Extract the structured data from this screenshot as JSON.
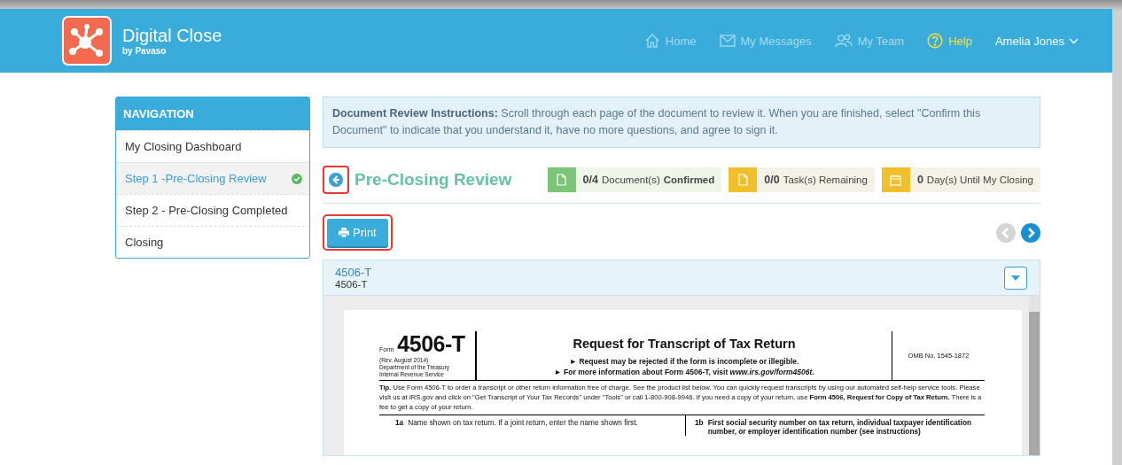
{
  "app": {
    "title": "Digital Close",
    "subtitle": "by Pavaso"
  },
  "top_nav": [
    {
      "label": "Home",
      "kind": "home"
    },
    {
      "label": "My Messages",
      "kind": "messages"
    },
    {
      "label": "My Team",
      "kind": "team"
    },
    {
      "label": "Help",
      "kind": "help"
    }
  ],
  "user": {
    "name": "Amelia Jones"
  },
  "sidebar": {
    "title": "NAVIGATION",
    "items": [
      {
        "label": "My Closing Dashboard",
        "selected": false,
        "completed": false
      },
      {
        "label": "Step 1 -Pre-Closing Review",
        "selected": true,
        "completed": true
      },
      {
        "label": "Step 2 - Pre-Closing Completed",
        "selected": false,
        "completed": false
      },
      {
        "label": "Closing",
        "selected": false,
        "completed": false
      }
    ]
  },
  "instructions": {
    "text": "**Document Review Instructions:** Scroll through each page of the document to review it. When you are finished, select \"Confirm this Document\" to indicate that you understand it, have no more questions, and agree to sign it."
  },
  "page_title": "Pre-Closing Review",
  "back_button": {
    "highlighted": true
  },
  "stats": [
    {
      "count": "0/4",
      "label": "Document(s) **Confirmed**",
      "color": "#7cc576",
      "kind": "document"
    },
    {
      "count": "0/0",
      "label": "Task(s) Remaining",
      "color": "#f0c02c",
      "kind": "document"
    },
    {
      "count": "0",
      "label": "Day(s) Until My Closing",
      "color": "#f0c02c",
      "kind": "calendar"
    }
  ],
  "print_button": {
    "label": "Print",
    "highlighted": true
  },
  "pager": {
    "previous_disabled": true,
    "next_disabled": false
  },
  "document": {
    "title": "4506-T",
    "subtitle": "4506-T",
    "form_word": "Form",
    "form_number": "4506-T",
    "revision": "(Rev. August 2014)",
    "department": "Department of the Treasury",
    "service": "Internal Revenue Service",
    "heading": "Request for Transcript of Tax Return",
    "notes": [
      "► Request may be rejected if the form is incomplete or illegible.",
      "► For more information about Form 4506-T, visit *www.irs.gov/form4506t*."
    ],
    "omb": "OMB No. 1545-1872",
    "tip": "**Tip.** Use Form 4506-T to order a transcript or other return information free of charge. See the product list below. You can quickly request transcripts by using our automated self-help service tools. Please visit us at IRS.gov and click on \"Get Transcript of Your Tax Records\" under \"Tools\" or call 1-800-908-9946. If you need a copy of your return, use **Form 4506, Request for Copy of Tax Return.** There is a fee to get a copy of your return.",
    "lines": [
      {
        "number": "1a",
        "text": "Name shown on tax return. If a joint return, enter the name shown first.",
        "kind": "normal"
      },
      {
        "number": "1b",
        "text": "First social security number on tax return, individual taxpayer identification number, or employer identification number (see instructions)",
        "kind": "bold"
      }
    ]
  }
}
